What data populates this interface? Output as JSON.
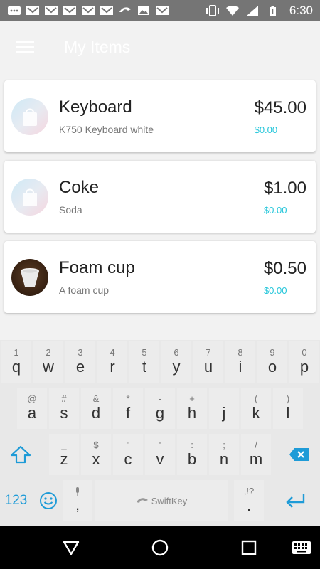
{
  "status_bar": {
    "time": "6:30",
    "icons": [
      "gmail-icon",
      "gmail-icon",
      "gmail-icon",
      "gmail-icon",
      "gmail-icon",
      "gmail-icon",
      "swiftkey-icon",
      "image-icon",
      "gmail-icon",
      "vibrate-icon",
      "wifi-icon",
      "signal-icon",
      "battery-icon"
    ]
  },
  "app_bar": {
    "title": "My Items",
    "menu_icon": "hamburger-menu-icon"
  },
  "items": [
    {
      "name": "Keyboard",
      "description": "K750 Keyboard white",
      "price": "$45.00",
      "sub_price": "$0.00",
      "thumbnail": "shopping-bag-icon"
    },
    {
      "name": "Coke",
      "description": "Soda",
      "price": "$1.00",
      "sub_price": "$0.00",
      "thumbnail": "shopping-bag-icon"
    },
    {
      "name": "Foam cup",
      "description": "A foam cup",
      "price": "$0.50",
      "sub_price": "$0.00",
      "thumbnail": "foam-cup-photo"
    }
  ],
  "keyboard": {
    "row1": [
      {
        "hint": "1",
        "key": "q"
      },
      {
        "hint": "2",
        "key": "w"
      },
      {
        "hint": "3",
        "key": "e"
      },
      {
        "hint": "4",
        "key": "r"
      },
      {
        "hint": "5",
        "key": "t"
      },
      {
        "hint": "6",
        "key": "y"
      },
      {
        "hint": "7",
        "key": "u"
      },
      {
        "hint": "8",
        "key": "i"
      },
      {
        "hint": "9",
        "key": "o"
      },
      {
        "hint": "0",
        "key": "p"
      }
    ],
    "row2": [
      {
        "hint": "@",
        "key": "a"
      },
      {
        "hint": "#",
        "key": "s"
      },
      {
        "hint": "&",
        "key": "d"
      },
      {
        "hint": "*",
        "key": "f"
      },
      {
        "hint": "-",
        "key": "g"
      },
      {
        "hint": "+",
        "key": "h"
      },
      {
        "hint": "=",
        "key": "j"
      },
      {
        "hint": "(",
        "key": "k"
      },
      {
        "hint": ")",
        "key": "l"
      }
    ],
    "row3": [
      {
        "hint": "_",
        "key": "z"
      },
      {
        "hint": "$",
        "key": "x"
      },
      {
        "hint": "\"",
        "key": "c"
      },
      {
        "hint": "'",
        "key": "v"
      },
      {
        "hint": ":",
        "key": "b"
      },
      {
        "hint": ";",
        "key": "n"
      },
      {
        "hint": "/",
        "key": "m"
      }
    ],
    "num_label": "123",
    "comma_hint": "🎤",
    "comma": ",",
    "space_label": "SwiftKey",
    "period_hint": ",!?",
    "period": ".",
    "accent_color": "#1e9bd7"
  },
  "nav_bar": {
    "icons": [
      "back-triangle-icon",
      "home-circle-icon",
      "recents-square-icon",
      "keyboard-switch-icon"
    ]
  },
  "colors": {
    "background": "#f2f2f2",
    "status_bar": "#757575",
    "accent": "#26c6da"
  }
}
